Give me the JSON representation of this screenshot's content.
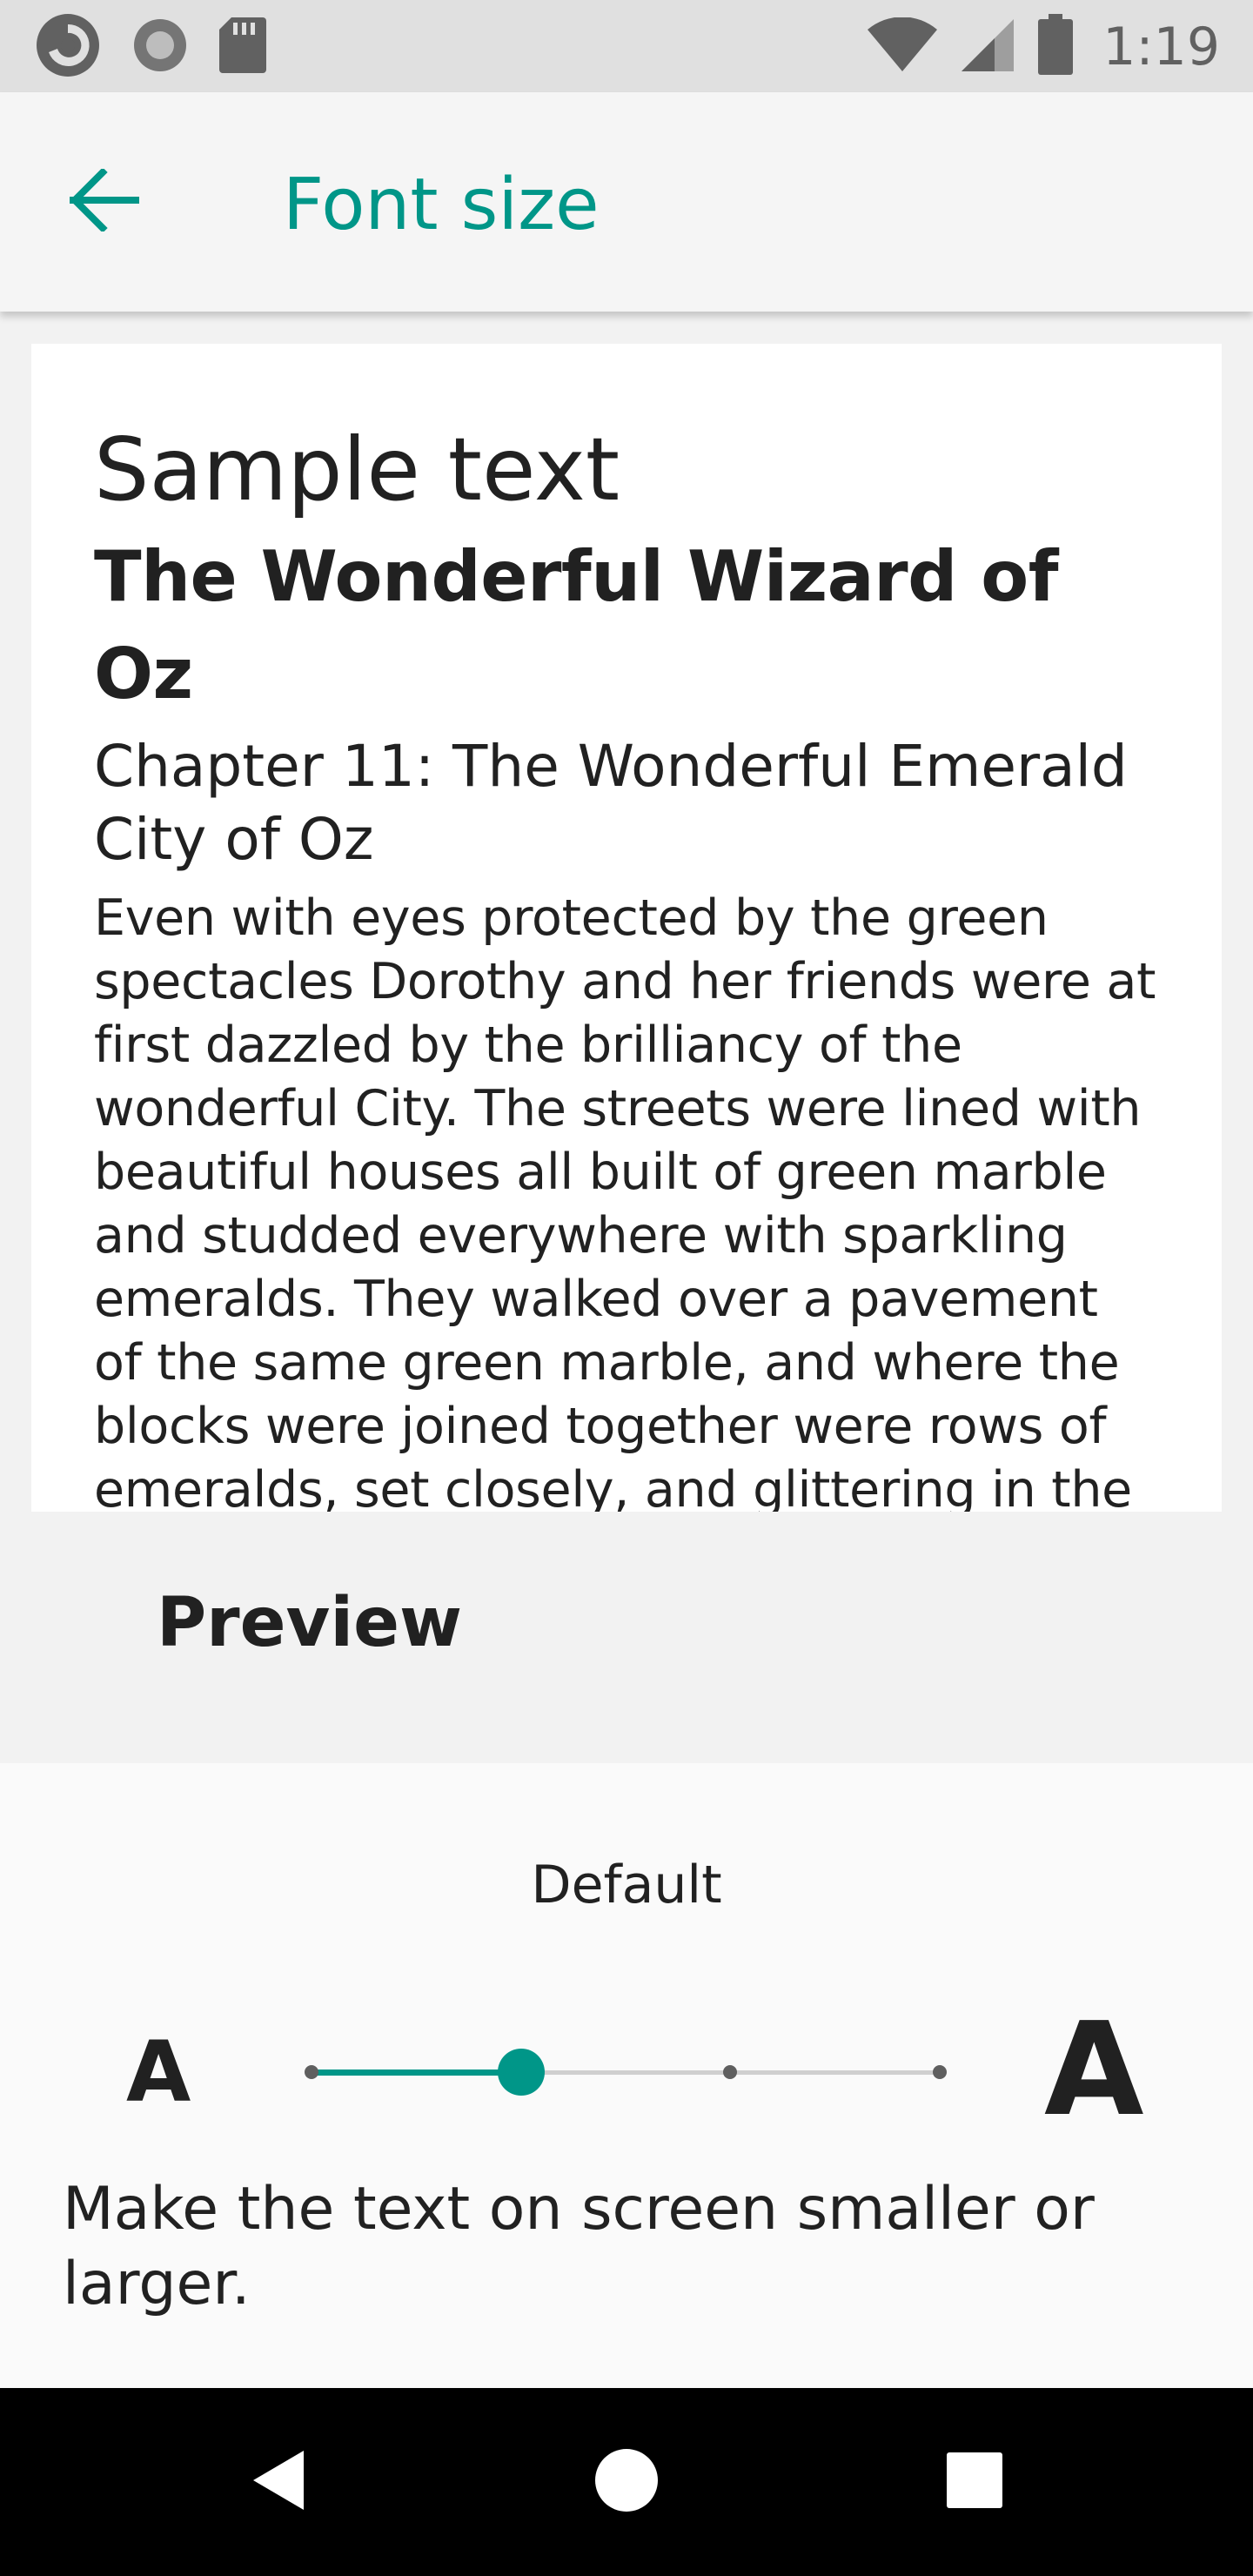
{
  "status_bar": {
    "time": "1:19",
    "icons": [
      "sync-icon",
      "record-icon",
      "sd-card-icon",
      "wifi-icon",
      "signal-icon",
      "battery-icon"
    ]
  },
  "app_bar": {
    "title": "Font size",
    "back_icon": "arrow-back-icon"
  },
  "preview": {
    "heading": "Sample text",
    "book_title": "The Wonderful Wizard of Oz",
    "chapter_title": "Chapter 11: The Wonderful Emerald City of Oz",
    "body": "Even with eyes protected by the green spectacles Dorothy and her friends were at first dazzled by the brilliancy of the wonderful City. The streets were lined with beautiful houses all built of green marble and studded everywhere with sparkling emeralds. They walked over a pavement of the same green marble, and where the blocks were joined together were rows of emeralds, set closely, and glittering in the brightness of the sun. The window panes were of green glass; even the sky above the City had a green tint, and the rays of the sun were green.",
    "label": "Preview"
  },
  "font_size_control": {
    "current_value": "Default",
    "small_label": "A",
    "large_label": "A",
    "levels": 4,
    "selected_level": 2,
    "description": "Make the text on screen smaller or larger."
  },
  "colors": {
    "accent": "#009688",
    "status_bar": "#e0e0e0",
    "app_bar": "#f5f5f5",
    "nav_bar": "#000000"
  },
  "nav_bar": {
    "buttons": [
      "back-triangle-icon",
      "home-circle-icon",
      "recents-square-icon"
    ]
  }
}
